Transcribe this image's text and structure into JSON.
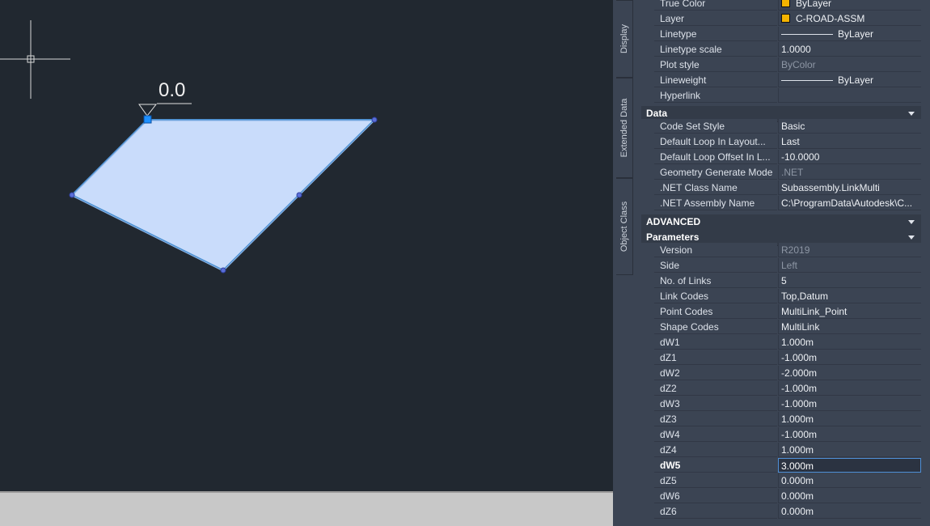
{
  "canvas": {
    "elevation_label": "0.0"
  },
  "side_tabs": [
    "Display",
    "Extended Data",
    "Object Class"
  ],
  "general_rows": [
    {
      "label": "True Color",
      "value": "ByLayer",
      "kind": "swatch"
    },
    {
      "label": "Layer",
      "value": "C-ROAD-ASSM",
      "kind": "swatch"
    },
    {
      "label": "Linetype",
      "value": "ByLayer",
      "kind": "line"
    },
    {
      "label": "Linetype scale",
      "value": "1.0000",
      "kind": "text"
    },
    {
      "label": "Plot style",
      "value": "ByColor",
      "kind": "readonly"
    },
    {
      "label": "Lineweight",
      "value": "ByLayer",
      "kind": "line"
    },
    {
      "label": "Hyperlink",
      "value": "",
      "kind": "text"
    }
  ],
  "data_section": {
    "title": "Data",
    "rows": [
      {
        "label": "Code Set Style",
        "value": "Basic",
        "kind": "text"
      },
      {
        "label": "Default Loop In Layout...",
        "value": "Last",
        "kind": "text"
      },
      {
        "label": "Default Loop Offset In L...",
        "value": "-10.0000",
        "kind": "text"
      },
      {
        "label": "Geometry Generate Mode",
        "value": ".NET",
        "kind": "readonly"
      },
      {
        "label": ".NET Class Name",
        "value": "Subassembly.LinkMulti",
        "kind": "text"
      },
      {
        "label": ".NET Assembly Name",
        "value": "C:\\ProgramData\\Autodesk\\C...",
        "kind": "text"
      }
    ]
  },
  "advanced_section": {
    "title": "ADVANCED"
  },
  "parameters_section": {
    "title": "Parameters",
    "rows": [
      {
        "label": "Version",
        "value": "R2019",
        "kind": "readonly"
      },
      {
        "label": "Side",
        "value": "Left",
        "kind": "readonly"
      },
      {
        "label": "No. of Links",
        "value": "5",
        "kind": "text"
      },
      {
        "label": "Link Codes",
        "value": "Top,Datum",
        "kind": "text"
      },
      {
        "label": "Point Codes",
        "value": "MultiLink_Point",
        "kind": "text"
      },
      {
        "label": "Shape Codes",
        "value": "MultiLink",
        "kind": "text"
      },
      {
        "label": "dW1",
        "value": "1.000m",
        "kind": "text"
      },
      {
        "label": "dZ1",
        "value": "-1.000m",
        "kind": "text"
      },
      {
        "label": "dW2",
        "value": "-2.000m",
        "kind": "text"
      },
      {
        "label": "dZ2",
        "value": "-1.000m",
        "kind": "text"
      },
      {
        "label": "dW3",
        "value": "-1.000m",
        "kind": "text"
      },
      {
        "label": "dZ3",
        "value": "1.000m",
        "kind": "text"
      },
      {
        "label": "dW4",
        "value": "-1.000m",
        "kind": "text"
      },
      {
        "label": "dZ4",
        "value": "1.000m",
        "kind": "text"
      },
      {
        "label": "dW5",
        "value": "3.000m",
        "kind": "editing"
      },
      {
        "label": "dZ5",
        "value": "0.000m",
        "kind": "text"
      },
      {
        "label": "dW6",
        "value": "0.000m",
        "kind": "text"
      },
      {
        "label": "dZ6",
        "value": "0.000m",
        "kind": "text"
      }
    ]
  },
  "colors": {
    "shape_fill": "#c9dcfb",
    "shape_stroke": "#4a8fd0",
    "grip": "#1e90ff",
    "layer_swatch": "#f5b400"
  }
}
